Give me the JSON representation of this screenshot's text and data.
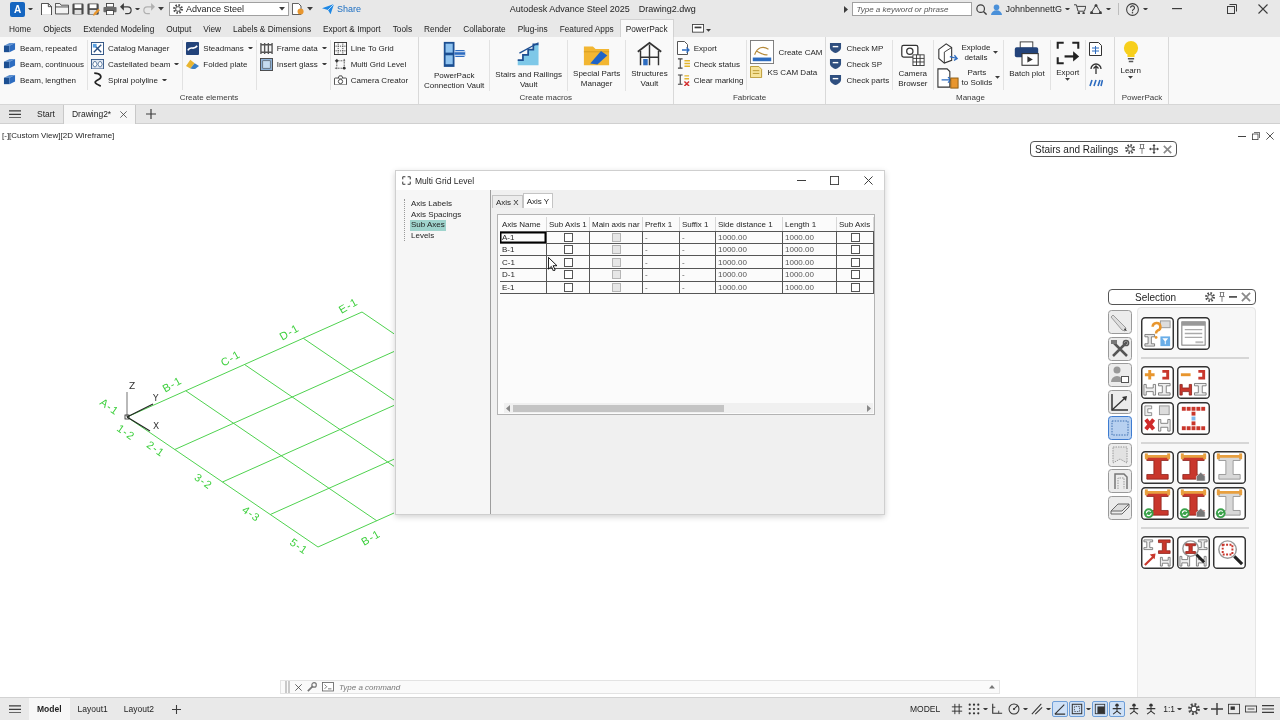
{
  "title_bar": {
    "logo": "A",
    "workspace": "Advance Steel",
    "share": "Share",
    "title": "Autodesk Advance Steel 2025",
    "file": "Drawing2.dwg",
    "search": {
      "placeholder": "Type a keyword or phrase"
    },
    "user": "JohnbennettG"
  },
  "ribbon": {
    "tabs": [
      {
        "label": "Home",
        "selected": false
      },
      {
        "label": "Objects",
        "selected": false
      },
      {
        "label": "Extended Modeling",
        "selected": false
      },
      {
        "label": "Output",
        "selected": false
      },
      {
        "label": "View",
        "selected": false
      },
      {
        "label": "Labels & Dimensions",
        "selected": false
      },
      {
        "label": "Export & Import",
        "selected": false
      },
      {
        "label": "Tools",
        "selected": false
      },
      {
        "label": "Render",
        "selected": false
      },
      {
        "label": "Collaborate",
        "selected": false
      },
      {
        "label": "Plug-ins",
        "selected": false
      },
      {
        "label": "Featured Apps",
        "selected": false
      },
      {
        "label": "PowerPack",
        "selected": true
      }
    ],
    "groups": [
      {
        "label": "Create elements",
        "columns": [
          {
            "kind": "small",
            "items": [
              {
                "label": "Beam, repeated",
                "dropdown": false
              },
              {
                "label": "Beam, continuous",
                "dropdown": false
              },
              {
                "label": "Beam, lengthen",
                "dropdown": false
              }
            ]
          },
          {
            "kind": "small",
            "items": [
              {
                "label": "Catalog Manager",
                "dropdown": false
              },
              {
                "label": "Castellated beam",
                "dropdown": true
              },
              {
                "label": "Spiral polyline",
                "dropdown": true
              }
            ]
          },
          {
            "kind": "small",
            "items": [
              {
                "label": "Steadmans",
                "dropdown": true
              },
              {
                "label": "Folded plate",
                "dropdown": false
              }
            ]
          },
          {
            "kind": "small",
            "items": [
              {
                "label": "Frame data",
                "dropdown": true
              },
              {
                "label": "Insert glass",
                "dropdown": true
              }
            ]
          },
          {
            "kind": "small",
            "items": [
              {
                "label": "Line To Grid",
                "dropdown": false
              },
              {
                "label": "Multi Grid Level",
                "dropdown": false
              },
              {
                "label": "Camera Creator",
                "dropdown": false
              }
            ]
          }
        ]
      },
      {
        "label": "Create macros",
        "columns": [
          {
            "kind": "large",
            "items": [
              {
                "label": "PowerPack\nConnection Vault",
                "dropdown": false
              }
            ]
          },
          {
            "kind": "large",
            "items": [
              {
                "label": "Stairs and Railings\nVault",
                "dropdown": false
              }
            ]
          },
          {
            "kind": "large",
            "items": [
              {
                "label": "Special Parts\nManager",
                "dropdown": false
              }
            ]
          },
          {
            "kind": "large",
            "items": [
              {
                "label": "Structures\nVault",
                "dropdown": false
              }
            ]
          }
        ]
      },
      {
        "label": "Fabricate",
        "columns": [
          {
            "kind": "small",
            "items": [
              {
                "label": "Export",
                "dropdown": false
              },
              {
                "label": "Check status",
                "dropdown": false
              },
              {
                "label": "Clear marking",
                "dropdown": false
              }
            ]
          },
          {
            "kind": "small",
            "items": [
              {
                "label": "Create CAM",
                "dropdown": false
              },
              {
                "label": "KS CAM Data",
                "dropdown": false
              }
            ]
          }
        ]
      },
      {
        "label": "Manage",
        "columns": [
          {
            "kind": "small",
            "items": [
              {
                "label": "Check MP",
                "dropdown": false
              },
              {
                "label": "Check SP",
                "dropdown": false
              },
              {
                "label": "Check parts",
                "dropdown": false
              }
            ]
          },
          {
            "kind": "large",
            "items": [
              {
                "label": "Camera\nBrowser",
                "dropdown": false
              }
            ]
          },
          {
            "kind": "stack",
            "items": [
              {
                "label": "Explode\ndetails",
                "dropdown": true
              },
              {
                "label": "Parts\nto Solids",
                "dropdown": true
              }
            ]
          },
          {
            "kind": "large",
            "items": [
              {
                "label": "Batch plot",
                "dropdown": false
              }
            ]
          },
          {
            "kind": "large",
            "items": [
              {
                "label": "Export",
                "dropdown": true
              }
            ]
          },
          {
            "kind": "icons",
            "items": [
              {
                "dropdown": false
              },
              {
                "dropdown": false
              },
              {
                "dropdown": false
              }
            ]
          }
        ]
      },
      {
        "label": "PowerPack",
        "columns": [
          {
            "kind": "large",
            "items": [
              {
                "label": "Learn",
                "dropdown": true
              }
            ]
          }
        ]
      }
    ]
  },
  "file_tabs": [
    {
      "label": "Start",
      "selected": false,
      "closable": false
    },
    {
      "label": "Drawing2*",
      "selected": true,
      "closable": true
    }
  ],
  "viewport": {
    "controls": [
      "[-]",
      "[Custom View]",
      "[2D Wireframe]"
    ]
  },
  "model": {
    "ucs": {
      "x": "X",
      "y": "Y",
      "z": "Z"
    },
    "column_labels": [
      "A-1",
      "B-1",
      "C-1",
      "D-1",
      "E-1"
    ],
    "row_labels": [
      "1-2",
      "2-1",
      "3-2",
      "4-3",
      "5-1"
    ],
    "end_labels": [
      "B-1"
    ]
  },
  "dialog": {
    "title": "Multi Grid Level",
    "tree": [
      {
        "label": "Axis Labels",
        "selected": false
      },
      {
        "label": "Axis Spacings",
        "selected": false
      },
      {
        "label": "Sub Axes",
        "selected": true
      },
      {
        "label": "Levels",
        "selected": false
      }
    ],
    "tabs": [
      {
        "label": "Axis X",
        "selected": false
      },
      {
        "label": "Axis Y",
        "selected": true
      }
    ],
    "table": {
      "columns": [
        "Axis Name",
        "Sub Axis 1",
        "Main axis nar",
        "Prefix 1",
        "Suffix 1",
        "Side distance 1",
        "Length 1",
        "Sub Axis"
      ],
      "rows": [
        {
          "focused": true,
          "cells": [
            {
              "kind": "text",
              "text": "A-1"
            },
            {
              "kind": "check",
              "checked": false,
              "disabled": false
            },
            {
              "kind": "check",
              "checked": false,
              "disabled": true
            },
            {
              "kind": "text",
              "text": "-"
            },
            {
              "kind": "text",
              "text": "-"
            },
            {
              "kind": "text",
              "text": "1000.00"
            },
            {
              "kind": "text",
              "text": "1000.00"
            },
            {
              "kind": "check",
              "checked": false,
              "disabled": false
            }
          ]
        },
        {
          "focused": false,
          "cells": [
            {
              "kind": "text",
              "text": "B-1"
            },
            {
              "kind": "check",
              "checked": false,
              "disabled": false
            },
            {
              "kind": "check",
              "checked": false,
              "disabled": true
            },
            {
              "kind": "text",
              "text": "-"
            },
            {
              "kind": "text",
              "text": "-"
            },
            {
              "kind": "text",
              "text": "1000.00"
            },
            {
              "kind": "text",
              "text": "1000.00"
            },
            {
              "kind": "check",
              "checked": false,
              "disabled": false
            }
          ]
        },
        {
          "focused": false,
          "cells": [
            {
              "kind": "text",
              "text": "C-1"
            },
            {
              "kind": "check",
              "checked": false,
              "disabled": false
            },
            {
              "kind": "check",
              "checked": false,
              "disabled": true
            },
            {
              "kind": "text",
              "text": "-"
            },
            {
              "kind": "text",
              "text": "-"
            },
            {
              "kind": "text",
              "text": "1000.00"
            },
            {
              "kind": "text",
              "text": "1000.00"
            },
            {
              "kind": "check",
              "checked": false,
              "disabled": false
            }
          ]
        },
        {
          "focused": false,
          "cells": [
            {
              "kind": "text",
              "text": "D-1"
            },
            {
              "kind": "check",
              "checked": false,
              "disabled": false
            },
            {
              "kind": "check",
              "checked": false,
              "disabled": true
            },
            {
              "kind": "text",
              "text": "-"
            },
            {
              "kind": "text",
              "text": "-"
            },
            {
              "kind": "text",
              "text": "1000.00"
            },
            {
              "kind": "text",
              "text": "1000.00"
            },
            {
              "kind": "check",
              "checked": false,
              "disabled": false
            }
          ]
        },
        {
          "focused": false,
          "cells": [
            {
              "kind": "text",
              "text": "E-1"
            },
            {
              "kind": "check",
              "checked": false,
              "disabled": false
            },
            {
              "kind": "check",
              "checked": false,
              "disabled": true
            },
            {
              "kind": "text",
              "text": "-"
            },
            {
              "kind": "text",
              "text": "-"
            },
            {
              "kind": "text",
              "text": "1000.00"
            },
            {
              "kind": "text",
              "text": "1000.00"
            },
            {
              "kind": "check",
              "checked": false,
              "disabled": false
            }
          ]
        }
      ]
    }
  },
  "stairs_toolbar": {
    "title": "Stairs and Railings"
  },
  "selection_palette": {
    "title": "Selection",
    "modes": [
      {
        "selected": false
      },
      {
        "selected": false
      },
      {
        "selected": false
      },
      {
        "selected": false
      },
      {
        "selected": true
      },
      {
        "selected": false
      },
      {
        "selected": false
      },
      {
        "selected": false
      }
    ]
  },
  "command_line": {
    "placeholder": "Type a command"
  },
  "status_bar": {
    "layouts": [
      {
        "label": "Model",
        "selected": true
      },
      {
        "label": "Layout1",
        "selected": false
      },
      {
        "label": "Layout2",
        "selected": false
      }
    ],
    "items": [
      {
        "kind": "label",
        "text": "MODEL"
      },
      {
        "kind": "toggle",
        "on": false
      },
      {
        "kind": "toggle",
        "on": false
      },
      {
        "kind": "caret"
      },
      {
        "kind": "toggle",
        "on": false
      },
      {
        "kind": "toggle",
        "on": false
      },
      {
        "kind": "caret"
      },
      {
        "kind": "toggle",
        "on": false
      },
      {
        "kind": "caret"
      },
      {
        "kind": "toggle",
        "on": true
      },
      {
        "kind": "toggle",
        "on": true
      },
      {
        "kind": "caret"
      },
      {
        "kind": "toggle",
        "on": true
      },
      {
        "kind": "toggle",
        "on": true
      },
      {
        "kind": "toggle",
        "on": false
      },
      {
        "kind": "toggle",
        "on": false
      },
      {
        "kind": "menu",
        "text": "1:1"
      },
      {
        "kind": "toggle",
        "on": false
      },
      {
        "kind": "caret"
      },
      {
        "kind": "toggle",
        "on": false
      },
      {
        "kind": "toggle",
        "on": false
      },
      {
        "kind": "toggle",
        "on": false
      },
      {
        "kind": "toggle",
        "on": false
      }
    ]
  }
}
